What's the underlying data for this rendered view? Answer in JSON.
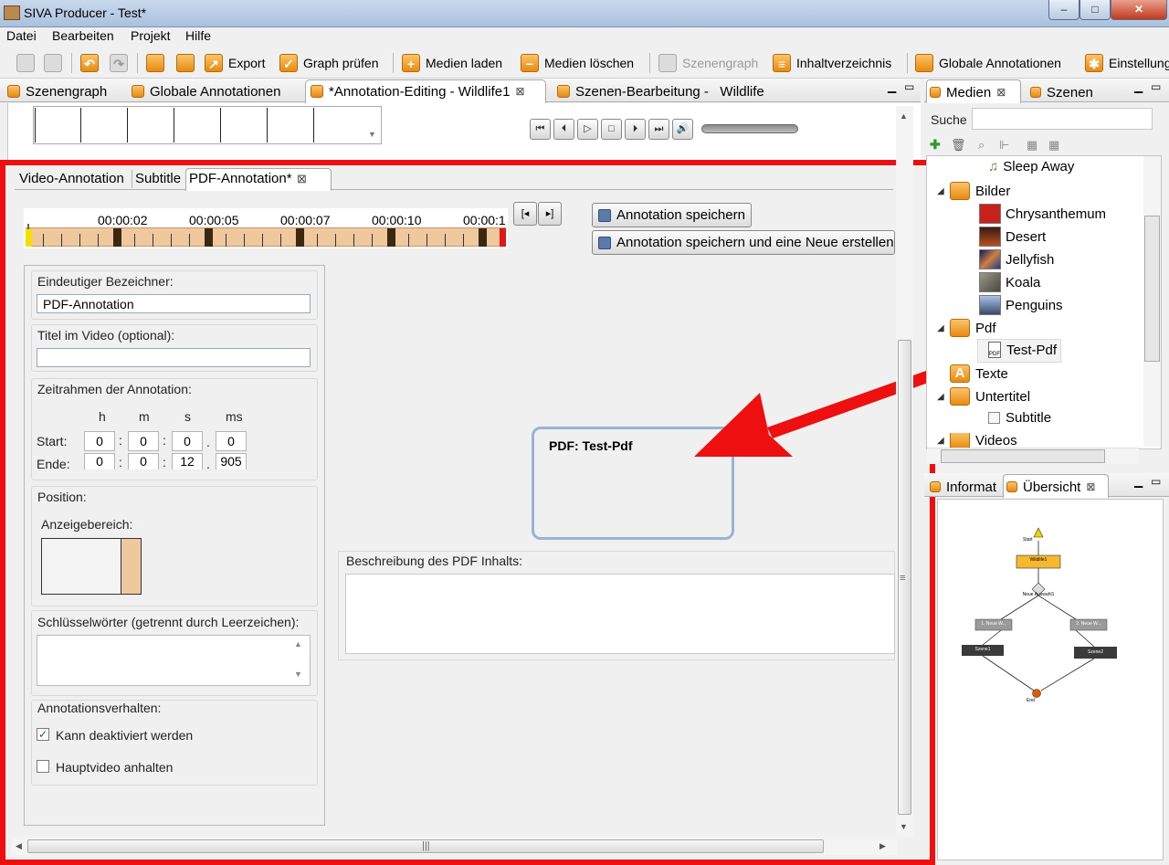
{
  "window": {
    "title": "SIVA Producer - Test*",
    "controls": [
      "–",
      "□",
      "✕"
    ]
  },
  "menu": [
    "Datei",
    "Bearbeiten",
    "Projekt",
    "Hilfe"
  ],
  "toolbar": {
    "export": "Export",
    "graph_check": "Graph prüfen",
    "load_media": "Medien laden",
    "delete_media": "Medien löschen",
    "scene_graph": "Szenengraph",
    "toc": "Inhaltverzeichnis",
    "global_annotations": "Globale Annotationen",
    "settings": "Einstellung"
  },
  "editor_tabs": [
    {
      "label": "Szenengraph"
    },
    {
      "label": "Globale Annotationen"
    },
    {
      "label": "*Annotation-Editing - Wildlife1"
    },
    {
      "label": "Szenen-Bearbeitung -   Wildlife"
    }
  ],
  "sub_tabs": [
    "Video-Annotation",
    "Subtitle",
    "PDF-Annotation*"
  ],
  "timeline": {
    "labels": [
      "00:00:02",
      "00:00:05",
      "00:00:07",
      "00:00:10",
      "00:00:1"
    ]
  },
  "buttons": {
    "save": "Annotation speichern",
    "save_new": "Annotation speichern und eine Neue erstellen"
  },
  "form": {
    "identifier_label": "Eindeutiger Bezeichner:",
    "identifier_value": "PDF-Annotation",
    "title_label": "Titel im Video (optional):",
    "title_value": "",
    "timeframe_label": "Zeitrahmen der Annotation:",
    "col_h": "h",
    "col_m": "m",
    "col_s": "s",
    "col_ms": "ms",
    "start_label": "Start:",
    "end_label": "Ende:",
    "start": {
      "h": "0",
      "m": "0",
      "s": "0",
      "ms": "0"
    },
    "end": {
      "h": "0",
      "m": "0",
      "s": "12",
      "ms": "905"
    },
    "position_label": "Position:",
    "display_area_label": "Anzeigebereich:",
    "keywords_label": "Schlüsselwörter (getrennt durch Leerzeichen):",
    "behavior_label": "Annotationsverhalten:",
    "can_deactivate": "Kann deaktiviert werden",
    "can_deactivate_checked": true,
    "pause_main": "Hauptvideo anhalten",
    "pause_main_checked": false
  },
  "pdf_preview": "PDF: Test-Pdf",
  "description_label": "Beschreibung des PDF Inhalts:",
  "right_panel": {
    "tab_media": "Medien",
    "tab_scenes": "Szenen",
    "search_label": "Suche",
    "tree": [
      {
        "label": "Sleep Away",
        "type": "audio"
      },
      {
        "label": "Bilder",
        "type": "folder"
      },
      {
        "label": "Chrysanthemum",
        "type": "image",
        "color": "#c8201a"
      },
      {
        "label": "Desert",
        "type": "image",
        "color": "#b8501e"
      },
      {
        "label": "Jellyfish",
        "type": "image",
        "color": "#1a3c8c"
      },
      {
        "label": "Koala",
        "type": "image",
        "color": "#6c6a5c"
      },
      {
        "label": "Penguins",
        "type": "image",
        "color": "#7a9ac8"
      },
      {
        "label": "Pdf",
        "type": "folder"
      },
      {
        "label": "Test-Pdf",
        "type": "pdf"
      },
      {
        "label": "Texte",
        "type": "folder"
      },
      {
        "label": "Untertitel",
        "type": "folder"
      },
      {
        "label": "Subtitle",
        "type": "subtitle"
      },
      {
        "label": "Videos",
        "type": "folder"
      }
    ],
    "tab_info": "Informat",
    "tab_overview": "Übersicht",
    "graph_nodes": {
      "start": "Start",
      "wildlife": "Wildlife1",
      "fork": "Neue Auswahl1",
      "left_branch": "1. Neue W...",
      "right_branch": "2. Neue W...",
      "scene1": "Szene1",
      "scene2": "Szene2",
      "end": "End"
    }
  },
  "accent_colors": {
    "highlight": "#ee1010",
    "timeline": "#f0c89d",
    "pdf_border": "#98b4d4"
  }
}
